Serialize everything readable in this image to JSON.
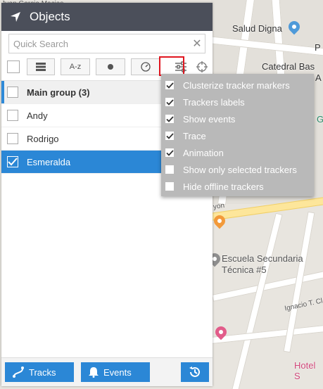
{
  "map": {
    "labels": {
      "street_top": "Juan Garcia Macias",
      "salud_digna": "Salud Digna",
      "catedral": "Catedral Bas",
      "a_fragment": "A",
      "escuela_line1": "Escuela Secundaria",
      "escuela_line2": "Técnica #5",
      "ignacio": "Ignacio T. Cl",
      "hotel": "Hotel S",
      "yon": "yon",
      "p_fragment": "P",
      "g_fragment": "G"
    }
  },
  "panel": {
    "title": "Objects",
    "search": {
      "placeholder": "Quick Search",
      "value": ""
    },
    "toolbar": {
      "sort_label": "A-z"
    },
    "group": {
      "label": "Main group (3)"
    },
    "trackers": [
      {
        "name": "Andy",
        "checked": false
      },
      {
        "name": "Rodrigo",
        "checked": false
      },
      {
        "name": "Esmeralda",
        "checked": true
      }
    ],
    "footer": {
      "tracks_label": "Tracks",
      "events_label": "Events"
    }
  },
  "dropdown": {
    "items": [
      {
        "label": "Clusterize tracker markers",
        "checked": true
      },
      {
        "label": "Trackers labels",
        "checked": true
      },
      {
        "label": "Show events",
        "checked": true
      },
      {
        "label": "Trace",
        "checked": true
      },
      {
        "label": "Animation",
        "checked": true
      },
      {
        "label": "Show only selected trackers",
        "checked": false
      },
      {
        "label": "Hide offline trackers",
        "checked": false
      }
    ]
  },
  "colors": {
    "header_bg": "#4b4f5a",
    "accent_blue": "#2b87d6",
    "highlight_red": "#e0151f",
    "dropdown_bg": "#b9b9b9"
  }
}
